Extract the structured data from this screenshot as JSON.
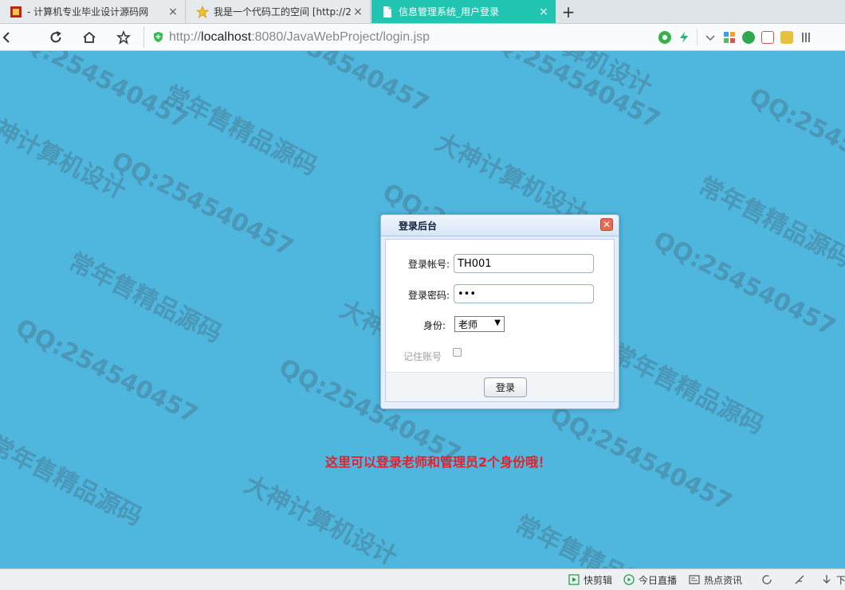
{
  "tabs": [
    {
      "label": "- 计算机专业毕业设计源码网",
      "icon": "red-site-favicon-icon",
      "active": false
    },
    {
      "label": "我是一个代码工的空间 [http://2",
      "icon": "star-favicon-icon",
      "active": false
    },
    {
      "label": "信息管理系统_用户登录",
      "icon": "document-favicon-icon",
      "active": true
    }
  ],
  "new_tab_label": "+",
  "tab_close_glyph": "×",
  "address": {
    "scheme": "http://",
    "host": "localhost",
    "rest": ":8080/JavaWebProject/login.jsp"
  },
  "watermarks": [
    "QQ:254540457",
    "常年售精品源码",
    "大神计算机设计"
  ],
  "dialog": {
    "title": "登录后台",
    "close_glyph": "✕",
    "account_label": "登录帐号:",
    "account_value": "TH001",
    "password_label": "登录密码:",
    "password_value": "•••",
    "role_label": "身份:",
    "role_value": "老师",
    "remember_label": "记住账号",
    "submit_label": "登录"
  },
  "notice": "这里可以登录老师和管理员2个身份哦！",
  "statusbar": {
    "items": [
      "快剪辑",
      "今日直播",
      "热点资讯"
    ],
    "right_label": "下"
  },
  "colors": {
    "page_bg": "#4fb6dd",
    "active_tab": "#21c3b1",
    "notice": "#e3202c"
  }
}
